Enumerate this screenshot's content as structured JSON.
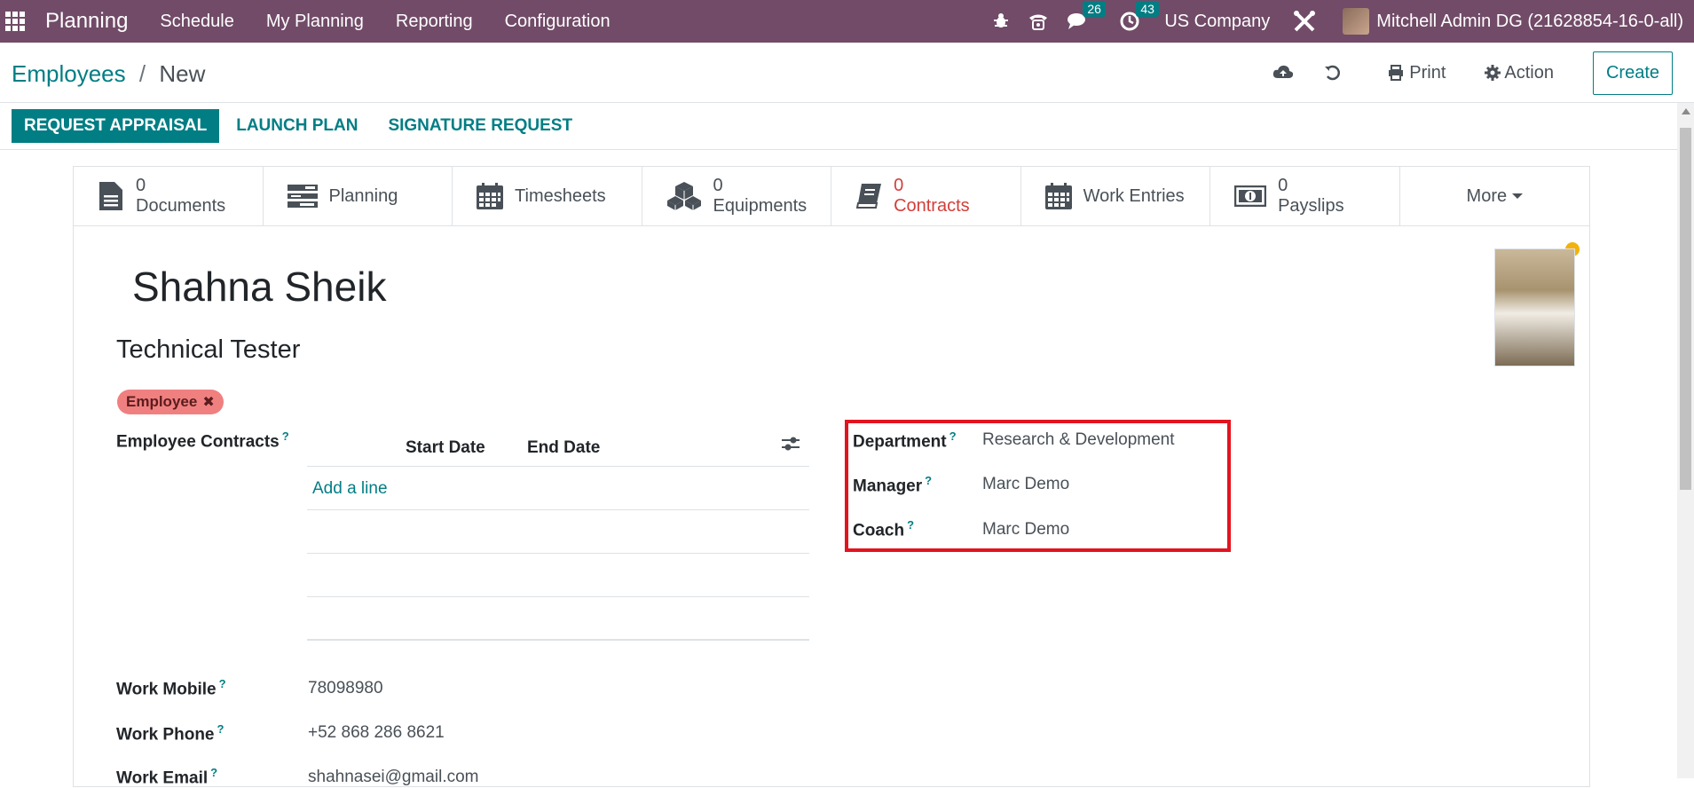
{
  "navbar": {
    "app_title": "Planning",
    "menu": [
      "Schedule",
      "My Planning",
      "Reporting",
      "Configuration"
    ],
    "messages_count": "26",
    "activities_count": "43",
    "company": "US Company",
    "user": "Mitchell Admin DG (21628854-16-0-all)"
  },
  "breadcrumb": {
    "parent": "Employees",
    "separator": "/",
    "current": "New"
  },
  "control_panel": {
    "print_label": "Print",
    "action_label": "Action",
    "create_label": "Create"
  },
  "statusbar": {
    "request_appraisal": "REQUEST APPRAISAL",
    "launch_plan": "LAUNCH PLAN",
    "signature_request": "SIGNATURE REQUEST"
  },
  "smart_buttons": {
    "documents": {
      "value": "0",
      "label": "Documents"
    },
    "planning": {
      "label": "Planning"
    },
    "timesheets": {
      "label": "Timesheets"
    },
    "equipments": {
      "value": "0",
      "label": "Equipments"
    },
    "contracts": {
      "value": "0",
      "label": "Contracts"
    },
    "work_entries": {
      "label": "Work Entries"
    },
    "payslips": {
      "value": "0",
      "label": "Payslips"
    },
    "more": {
      "label": "More"
    }
  },
  "employee": {
    "name": "Shahna Sheik",
    "job_title": "Technical Tester",
    "tag": "Employee"
  },
  "contracts_table": {
    "field_label": "Employee Contracts",
    "columns": [
      "Start Date",
      "End Date"
    ],
    "add_line": "Add a line"
  },
  "fields": {
    "department": {
      "label": "Department",
      "value": "Research & Development"
    },
    "manager": {
      "label": "Manager",
      "value": "Marc Demo"
    },
    "coach": {
      "label": "Coach",
      "value": "Marc Demo"
    },
    "work_mobile": {
      "label": "Work Mobile",
      "value": "78098980"
    },
    "work_phone": {
      "label": "Work Phone",
      "value": "+52 868 286 8621"
    },
    "work_email": {
      "label": "Work Email",
      "value": "shahnasei@gmail.com"
    }
  },
  "help_mark": "?",
  "colors": {
    "navbar": "#714b67",
    "accent": "#017e84",
    "highlight": "#e2141f",
    "tag": "#f08080"
  }
}
